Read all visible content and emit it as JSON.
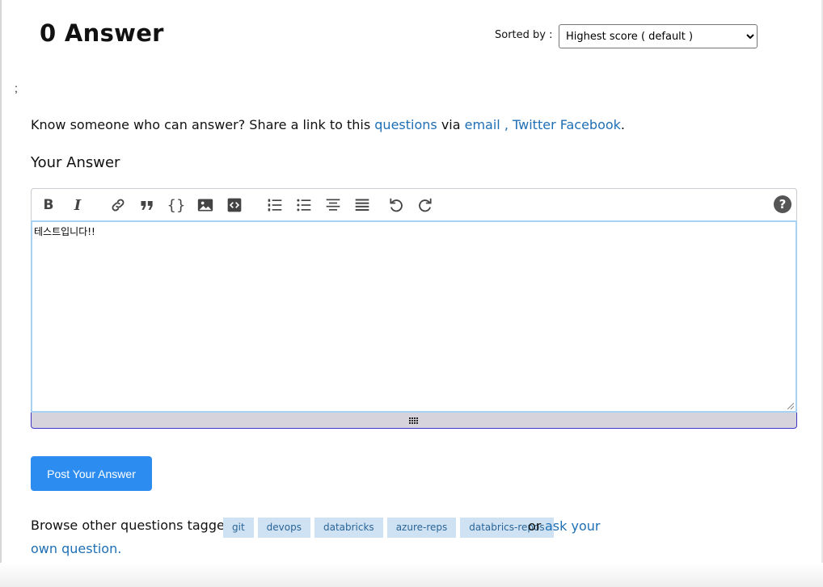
{
  "answers": {
    "heading": "0 Answer"
  },
  "sort": {
    "label": "Sorted by :",
    "selected": "Highest score ( default )"
  },
  "stray_text": ";",
  "share": {
    "prefix": "Know someone who can answer? Share a link to this ",
    "questions_link": "questions",
    "via": " via ",
    "email_link": "email ,",
    "twitter_link": "Twitter",
    "facebook_link": "Facebook",
    "suffix": "."
  },
  "your_answer": {
    "title": "Your Answer"
  },
  "toolbar": {
    "icons": [
      "bold-icon",
      "italic-icon",
      "link-icon",
      "blockquote-icon",
      "code-icon",
      "image-icon",
      "snippet-icon",
      "ordered-list-icon",
      "unordered-list-icon",
      "align-center-icon",
      "justify-icon",
      "undo-icon",
      "redo-icon",
      "help-icon"
    ],
    "bold": "B",
    "italic": "I",
    "code": "{}",
    "help": "?"
  },
  "editor": {
    "value": "테스트입니다!!"
  },
  "post_button": {
    "label": "Post Your Answer"
  },
  "browse": {
    "prefix": "Browse other questions tagged",
    "tags": [
      "git",
      "devops",
      "databricks",
      "azure-reps",
      "databrics-repos"
    ],
    "or": "or",
    "ask_link_line1": "ask your",
    "ask_link_line2": "own question."
  },
  "colors": {
    "link": "#1f6fb5",
    "button": "#2d8cf0",
    "tag_bg": "#cfe2f3",
    "editor_border": "#a7d2f3"
  }
}
